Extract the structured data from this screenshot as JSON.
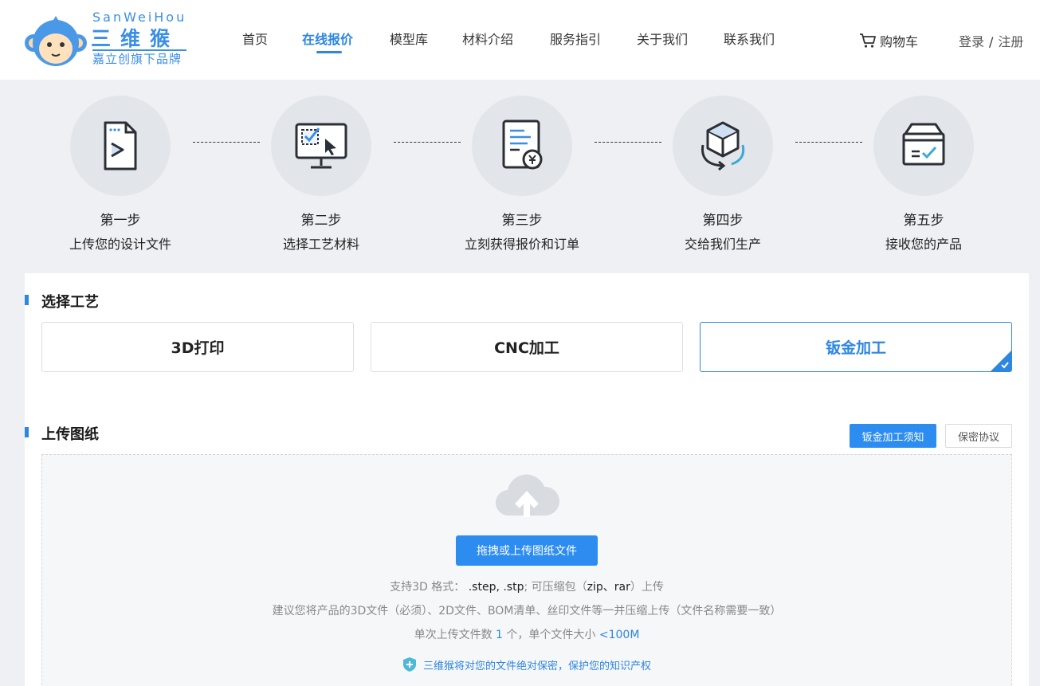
{
  "brand": {
    "name_en": "SanWeiHou",
    "name_cn": "三维猴",
    "slogan": "嘉立创旗下品牌",
    "color": "#3a8ee6"
  },
  "nav": {
    "items": [
      {
        "label": "首页",
        "active": false
      },
      {
        "label": "在线报价",
        "active": true
      },
      {
        "label": "模型库",
        "active": false
      },
      {
        "label": "材料介绍",
        "active": false
      },
      {
        "label": "服务指引",
        "active": false
      },
      {
        "label": "关于我们",
        "active": false
      },
      {
        "label": "联系我们",
        "active": false
      }
    ],
    "cart_label": "购物车",
    "cart_icon": "cart-icon",
    "login_label": "登录",
    "separator": "/",
    "register_label": "注册",
    "accent_color": "#2d86e0"
  },
  "steps": [
    {
      "title": "第一步",
      "desc": "上传您的设计文件",
      "icon": "upload-file-icon"
    },
    {
      "title": "第二步",
      "desc": "选择工艺材料",
      "icon": "monitor-select-icon"
    },
    {
      "title": "第三步",
      "desc": "立刻获得报价和订单",
      "icon": "quote-document-icon"
    },
    {
      "title": "第四步",
      "desc": "交给我们生产",
      "icon": "production-cube-icon"
    },
    {
      "title": "第五步",
      "desc": "接收您的产品",
      "icon": "delivery-box-icon"
    }
  ],
  "process": {
    "title": "选择工艺",
    "options": [
      {
        "label": "3D打印",
        "selected": false
      },
      {
        "label": "CNC加工",
        "selected": false
      },
      {
        "label": "钣金加工",
        "selected": true
      }
    ]
  },
  "upload": {
    "title": "上传图纸",
    "notice_button": "钣金加工须知",
    "privacy_button": "保密协议",
    "upload_button": "拖拽或上传图纸文件",
    "cloud_icon": "cloud-upload-icon",
    "formats_prefix": "支持3D 格式：",
    "formats": ".step, .stp",
    "compress_prefix": "; 可压缩包（",
    "compress_formats": "zip、rar",
    "compress_suffix": "）上传",
    "advice": "建议您将产品的3D文件（必须）、2D文件、BOM清单、丝印文件等一并压缩上传（文件名称需要一致）",
    "limit_prefix": "单次上传文件数",
    "limit_count": "1",
    "limit_mid": "个，单个文件大小",
    "limit_size": "<100M",
    "secure_text": "三维猴将对您的文件绝对保密，保护您的知识产权",
    "secure_icon": "shield-icon"
  }
}
